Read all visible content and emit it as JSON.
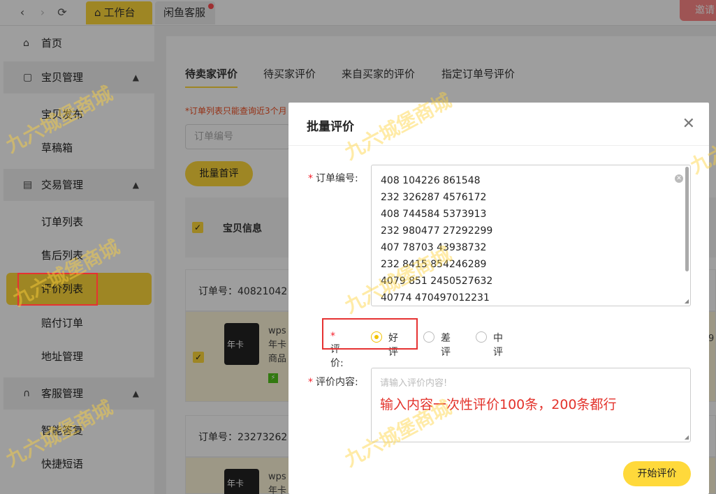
{
  "topbar": {
    "back_icon": "chevron-left-icon",
    "forward_icon": "chevron-right-icon",
    "refresh_icon": "refresh-icon",
    "tabs": [
      {
        "label": "工作台",
        "icon": "home-icon",
        "active": true
      },
      {
        "label": "闲鱼客服",
        "has_dot": true
      }
    ],
    "invite_label": "邀请"
  },
  "sidebar": {
    "items": [
      {
        "label": "首页",
        "icon": "home-outline-icon",
        "type": "link"
      },
      {
        "label": "宝贝管理",
        "icon": "bag-icon",
        "type": "group",
        "expanded": true
      },
      {
        "label": "宝贝发布",
        "type": "sub"
      },
      {
        "label": "草稿箱",
        "type": "sub"
      },
      {
        "label": "交易管理",
        "icon": "document-icon",
        "type": "group",
        "expanded": true
      },
      {
        "label": "订单列表",
        "type": "sub"
      },
      {
        "label": "售后列表",
        "type": "sub"
      },
      {
        "label": "评价列表",
        "type": "sub",
        "active": true
      },
      {
        "label": "赔付订单",
        "type": "sub"
      },
      {
        "label": "地址管理",
        "type": "sub"
      },
      {
        "label": "客服管理",
        "icon": "headset-icon",
        "type": "group",
        "expanded": true
      },
      {
        "label": "智能答复",
        "type": "sub"
      },
      {
        "label": "快捷短语",
        "type": "sub"
      }
    ]
  },
  "main": {
    "tabs": [
      {
        "label": "待卖家评价",
        "active": true
      },
      {
        "label": "待买家评价"
      },
      {
        "label": "来自买家的评价"
      },
      {
        "label": "指定订单号评价"
      }
    ],
    "notice": "*订单列表只能查询近3个月",
    "search_placeholder": "订单编号",
    "batch_button": "批量首评",
    "table_header": "宝贝信息",
    "orders": [
      {
        "order_label": "订单号：40821042",
        "product_title": "wps",
        "product_line2": "年卡",
        "product_line3": "商品",
        "thumb_text": "年卡",
        "right_text": "9"
      },
      {
        "order_label": "订单号：23273262",
        "product_title": "wps",
        "product_line2": "年卡",
        "thumb_text": "年卡"
      }
    ]
  },
  "modal": {
    "title": "批量评价",
    "close_icon": "close-icon",
    "order_field_label": "订单编号:",
    "order_numbers": [
      "408 104226   861548",
      "232 326287  4576172",
      "408 744584  5373913",
      "232 980477  27292299",
      "407 78703   43938732",
      "232 8415   854246289",
      "4079 851  2450527632",
      "40774   470497012231"
    ],
    "rating_label": "评价:",
    "rating_options": [
      "好评",
      "差评",
      "中评"
    ],
    "rating_selected": "好评",
    "content_label": "评价内容:",
    "content_placeholder": "请输入评价内容!",
    "annotation": "输入内容一次性评价100条，200条都行",
    "start_button": "开始评价"
  },
  "watermark": "九六城堡商城",
  "colors": {
    "brand_yellow": "#ffd93b",
    "alert_red": "#e63232",
    "annotation_red": "#e3322b"
  }
}
